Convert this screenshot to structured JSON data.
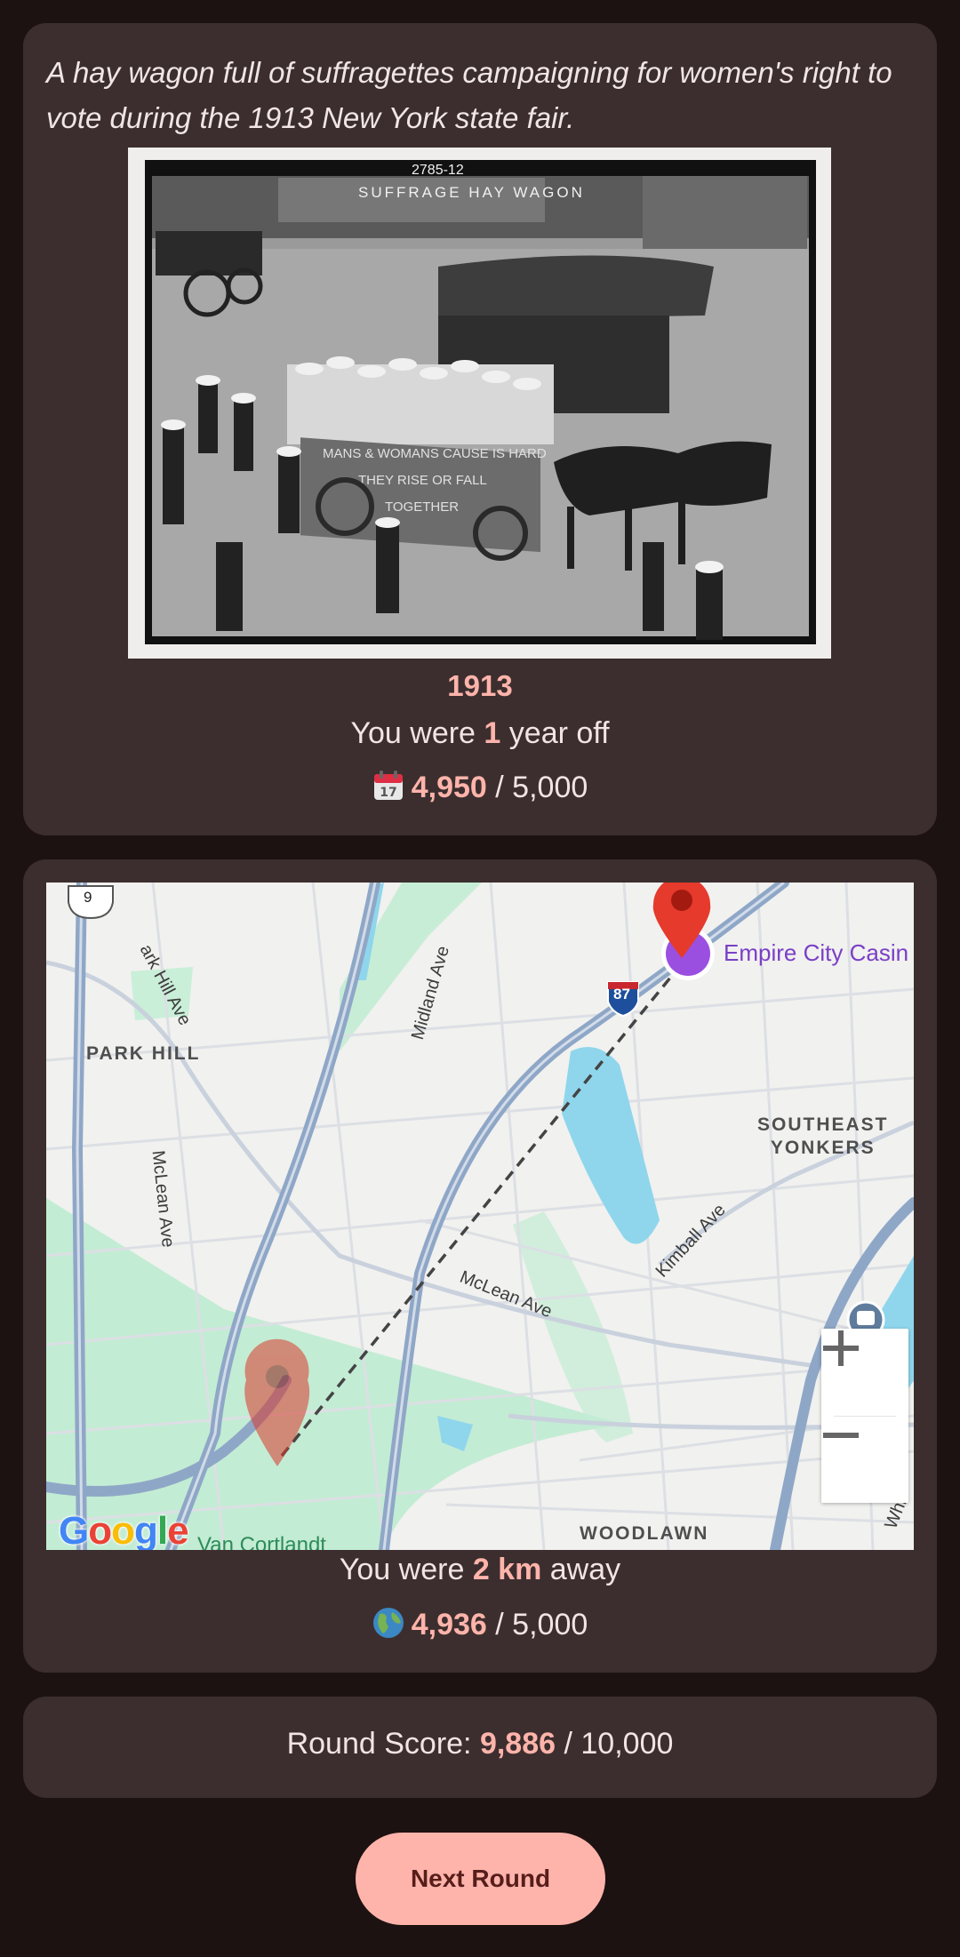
{
  "image_card": {
    "caption": "A hay wagon full of suffragettes campaigning for women's right to vote during the 1913 New York state fair.",
    "photo_text": {
      "negative_number": "2785-12",
      "sign_top": "SUFFRAGE HAY WAGON",
      "banner_line1": "MANS & WOMANS CAUSE IS HARD",
      "banner_line2": "THEY RISE OR FALL",
      "banner_line3": "TOGETHER"
    },
    "year": "1913",
    "year_off_prefix": "You were",
    "year_off_value": "1",
    "year_off_suffix": "year off",
    "year_score": "4,950",
    "year_score_max": "/ 5,000",
    "year_icon": "calendar-icon"
  },
  "map_card": {
    "labels": {
      "route_shield": "9",
      "park_hill_ave": "ark Hill Ave",
      "park_hill": "PARK HILL",
      "mclean_ave_vertical": "McLean Ave",
      "midland_ave": "Midland Ave",
      "interstate": "87",
      "casino": "Empire City Casin",
      "southeast_yonkers_1": "SOUTHEAST",
      "southeast_yonkers_2": "YONKERS",
      "kimball_ave": "Kimball Ave",
      "mclean_ave": "McLean Ave",
      "woodlawn": "WOODLAWN",
      "van_cortlandt": "Van Cortlandt",
      "white_plains": "Whit"
    },
    "zoom_in_label": "+",
    "zoom_out_label": "−",
    "google_logo": "Google",
    "distance_prefix": "You were",
    "distance_value": "2 km",
    "distance_suffix": "away",
    "location_score": "4,936",
    "location_score_max": "/ 5,000",
    "location_icon": "globe-icon"
  },
  "round_card": {
    "label": "Round Score:",
    "score": "9,886",
    "max": "/ 10,000"
  },
  "next_button": "Next Round",
  "colors": {
    "background": "#1d1212",
    "card": "#3c2e2e",
    "accent": "#ffb4ab",
    "button_text": "#561e1b"
  }
}
